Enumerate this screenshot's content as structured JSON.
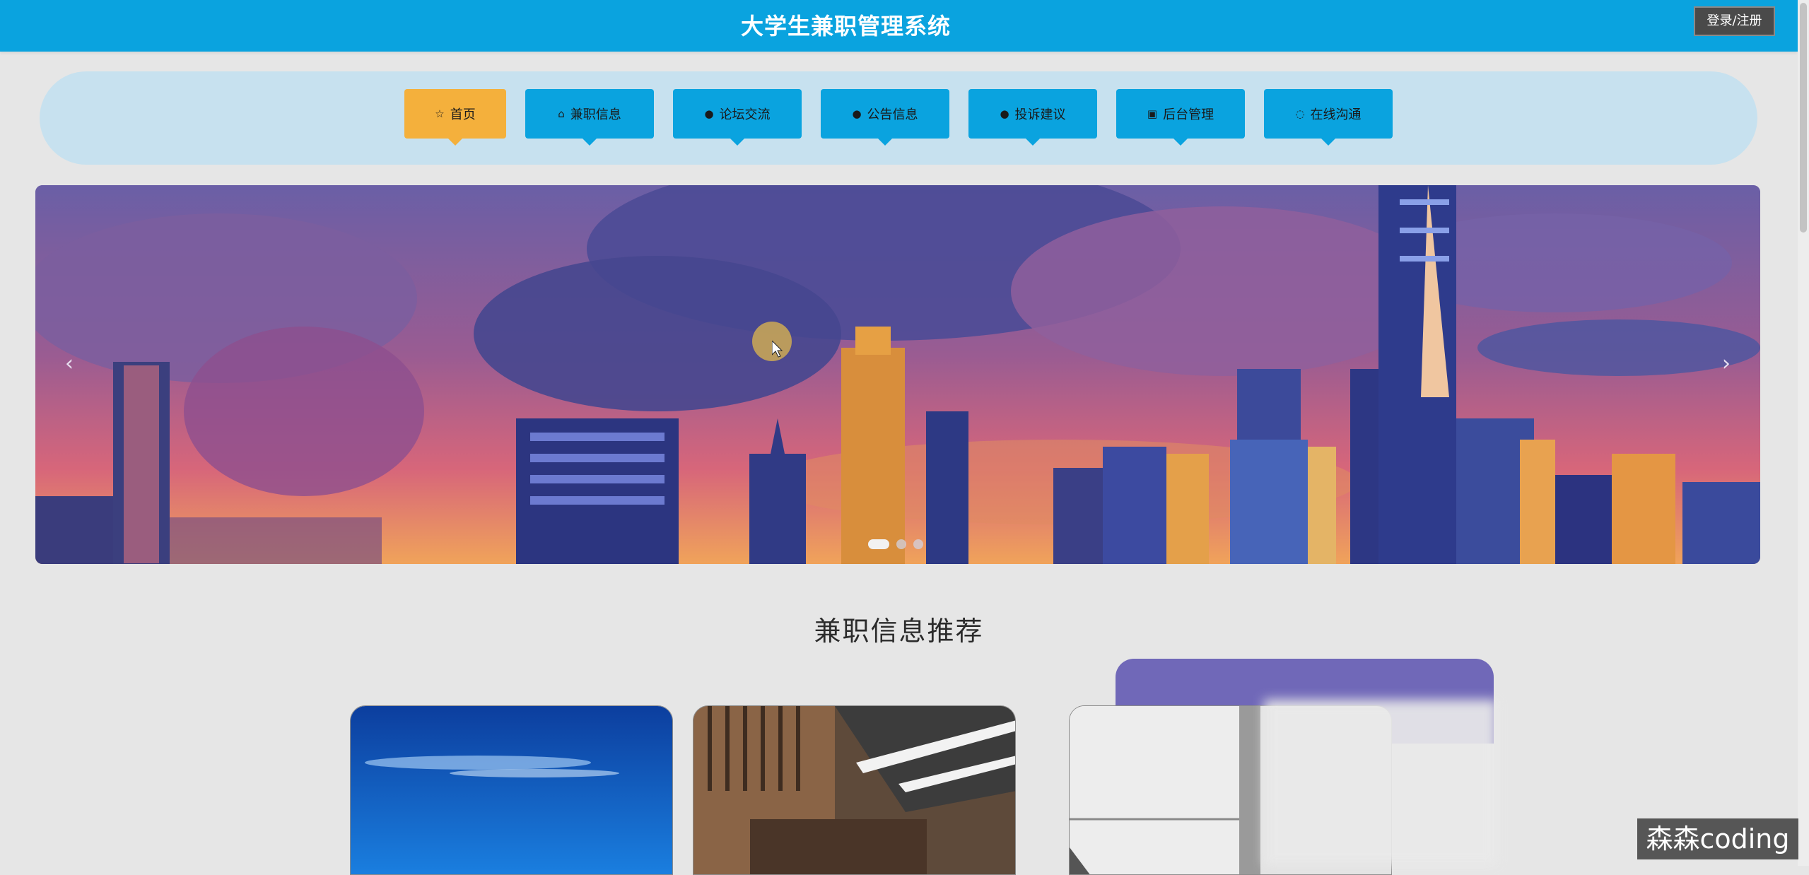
{
  "header": {
    "title": "大学生兼职管理系统",
    "login_label": "登录/注册"
  },
  "nav": {
    "items": [
      {
        "label": "首页",
        "icon": "star-icon",
        "glyph": "☆",
        "active": true
      },
      {
        "label": "兼职信息",
        "icon": "bag-icon",
        "glyph": "⌂",
        "active": false
      },
      {
        "label": "论坛交流",
        "icon": "info-circle-icon",
        "glyph": "●",
        "active": false
      },
      {
        "label": "公告信息",
        "icon": "question-circle-icon",
        "glyph": "●",
        "active": false
      },
      {
        "label": "投诉建议",
        "icon": "info-circle-icon",
        "glyph": "●",
        "active": false
      },
      {
        "label": "后台管理",
        "icon": "calendar-icon",
        "glyph": "▣",
        "active": false
      },
      {
        "label": "在线沟通",
        "icon": "chat-icon",
        "glyph": "◌",
        "active": false
      }
    ]
  },
  "banner": {
    "prev_glyph": "‹",
    "next_glyph": "›",
    "slide_count": 3,
    "active_slide": 1
  },
  "section": {
    "title": "兼职信息推荐"
  },
  "watermark": "森森coding",
  "colors": {
    "header_bg": "#0aa3df",
    "nav_band": "#c7e1ef",
    "nav_active": "#f4b03c",
    "nav_button": "#0aa3df",
    "purple_tab": "#7068b8"
  }
}
